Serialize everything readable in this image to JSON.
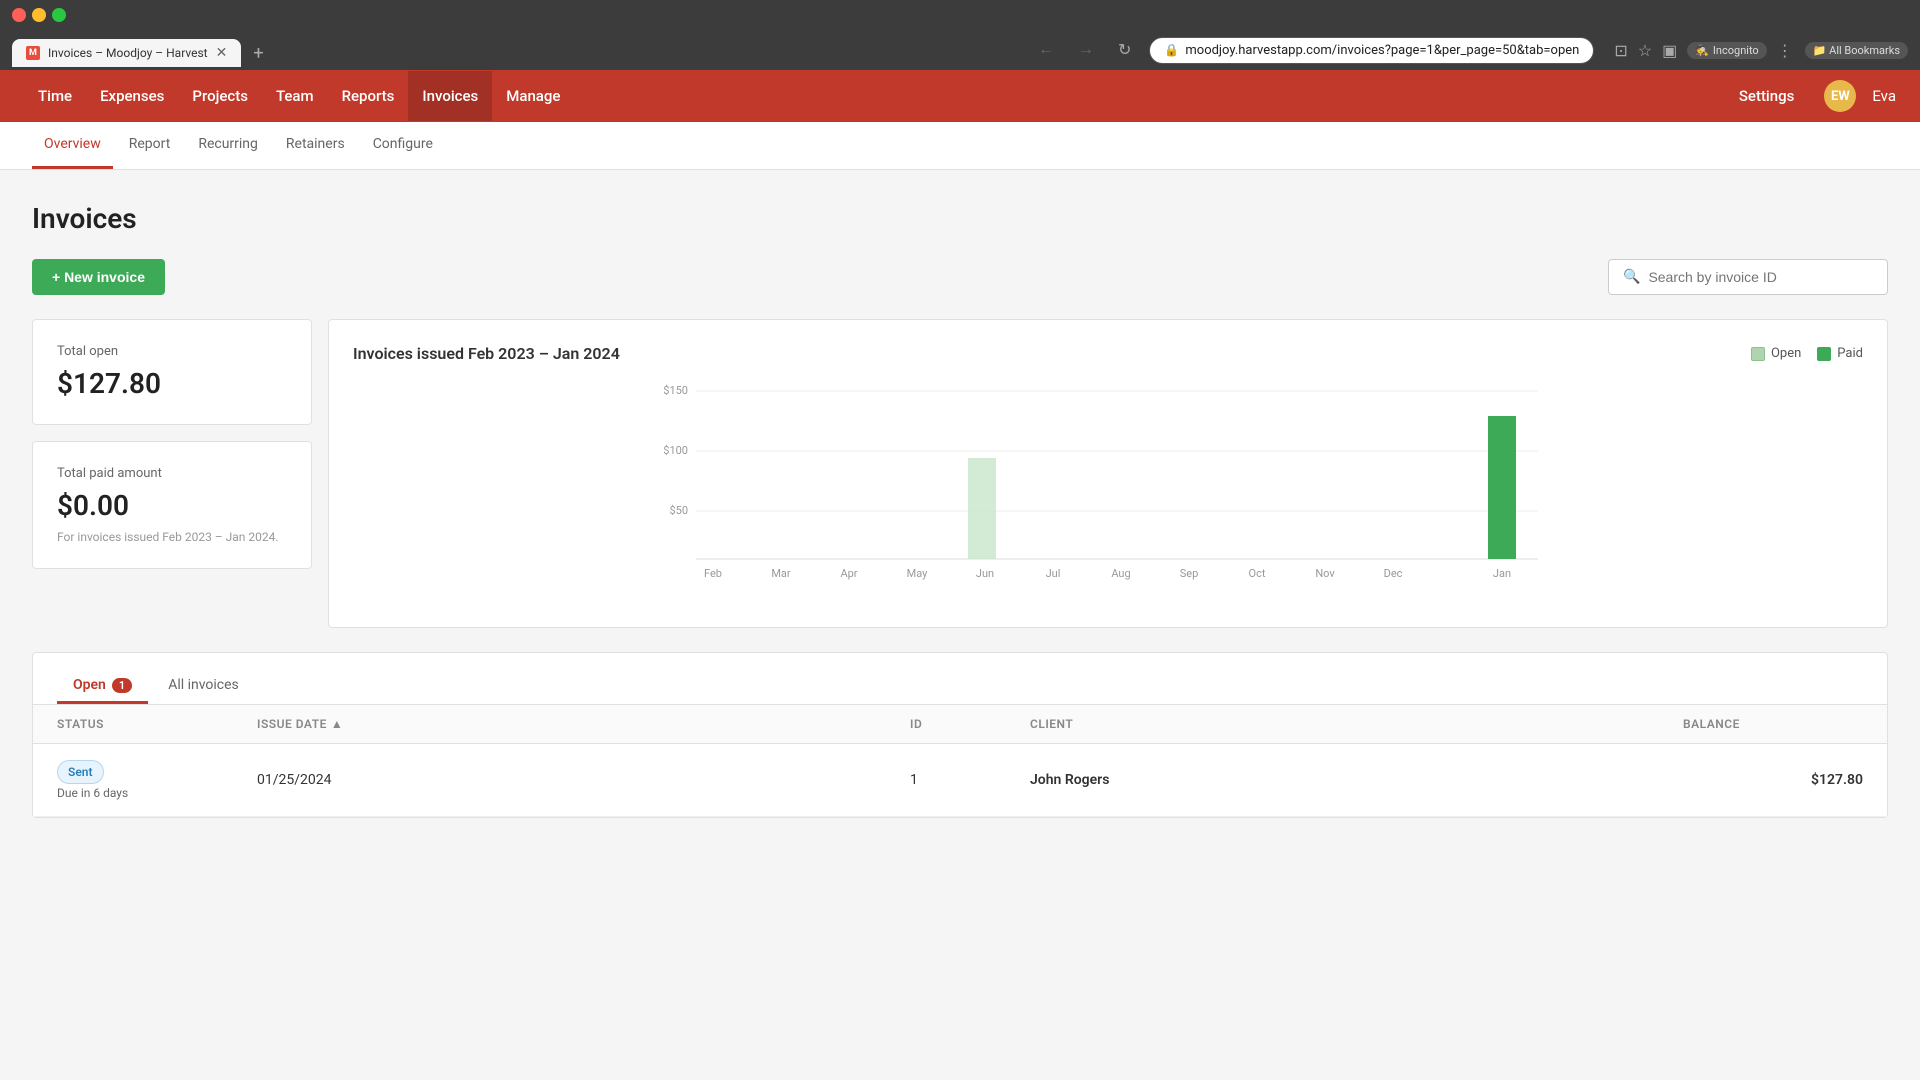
{
  "browser": {
    "url": "moodjoy.harvestapp.com/invoices?page=1&per_page=50&tab=open",
    "tab_title": "Invoices – Moodjoy – Harvest",
    "incognito_label": "Incognito",
    "bookmarks_label": "All Bookmarks"
  },
  "nav": {
    "items": [
      "Time",
      "Expenses",
      "Projects",
      "Team",
      "Reports",
      "Invoices",
      "Manage"
    ],
    "active": "Invoices",
    "settings_label": "Settings",
    "user_initials": "EW",
    "user_name": "Eva"
  },
  "sub_nav": {
    "items": [
      "Overview",
      "Report",
      "Recurring",
      "Retainers",
      "Configure"
    ],
    "active": "Overview"
  },
  "page": {
    "title": "Invoices",
    "new_button": "+ New invoice",
    "search_placeholder": "Search by invoice ID"
  },
  "stats": {
    "total_open_label": "Total open",
    "total_open_value": "$127.80",
    "total_paid_label": "Total paid amount",
    "total_paid_value": "$0.00",
    "total_paid_note": "For invoices issued Feb 2023 – Jan 2024."
  },
  "chart": {
    "title": "Invoices issued Feb 2023 – Jan 2024",
    "legend_open": "Open",
    "legend_paid": "Paid",
    "y_labels": [
      "$150",
      "$100",
      "$50"
    ],
    "x_labels": [
      "Feb",
      "Mar",
      "Apr",
      "May",
      "Jun",
      "Jul",
      "Aug",
      "Sep",
      "Oct",
      "Nov",
      "Dec",
      "Jan"
    ],
    "bars": [
      {
        "month": "Feb",
        "open": 0,
        "paid": 0
      },
      {
        "month": "Mar",
        "open": 0,
        "paid": 0
      },
      {
        "month": "Apr",
        "open": 0,
        "paid": 0
      },
      {
        "month": "May",
        "open": 0,
        "paid": 0
      },
      {
        "month": "Jun",
        "open": 90,
        "paid": 0
      },
      {
        "month": "Jul",
        "open": 0,
        "paid": 0
      },
      {
        "month": "Aug",
        "open": 0,
        "paid": 0
      },
      {
        "month": "Sep",
        "open": 0,
        "paid": 0
      },
      {
        "month": "Oct",
        "open": 0,
        "paid": 0
      },
      {
        "month": "Nov",
        "open": 0,
        "paid": 0
      },
      {
        "month": "Dec",
        "open": 0,
        "paid": 0
      },
      {
        "month": "Jan",
        "open": 0,
        "paid": 127.8
      }
    ],
    "max_value": 150
  },
  "invoices_tabs": {
    "open_label": "Open",
    "open_count": "1",
    "all_label": "All invoices"
  },
  "table": {
    "columns": [
      "Status",
      "Issue date",
      "ID",
      "Client",
      "Balance"
    ],
    "rows": [
      {
        "status": "Sent",
        "due": "Due in 6 days",
        "issue_date": "01/25/2024",
        "id": "1",
        "client": "John Rogers",
        "balance": "$127.80"
      }
    ]
  }
}
